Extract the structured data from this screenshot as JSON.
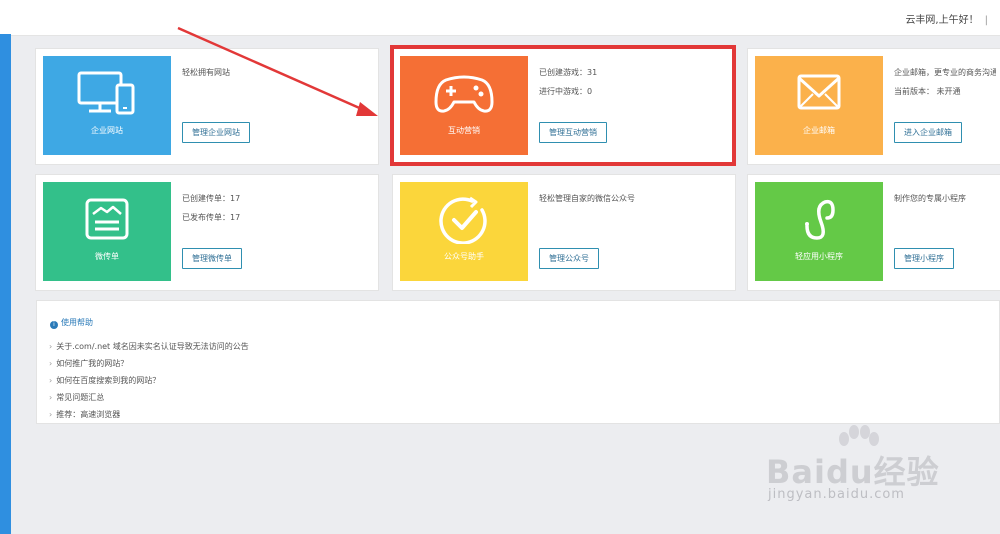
{
  "header": {
    "greeting": "云丰网,上午好！",
    "separator": "|"
  },
  "cards": [
    {
      "id": "website",
      "tile_label": "企业网站",
      "tile_color": "#3ea8e4",
      "icon": "monitor-phone-icon",
      "lines": [
        "轻松拥有网站"
      ],
      "button": "管理企业网站"
    },
    {
      "id": "marketing",
      "tile_label": "互动营销",
      "tile_color": "#f56f35",
      "icon": "gamepad-icon",
      "lines": [
        "已创建游戏：31",
        "进行中游戏：0"
      ],
      "button": "管理互动营销"
    },
    {
      "id": "mail",
      "tile_label": "企业邮箱",
      "tile_color": "#fbb14b",
      "icon": "envelope-icon",
      "lines": [
        "企业邮箱，更专业的商务沟通",
        "当前版本： 未开通"
      ],
      "button": "进入企业邮箱"
    },
    {
      "id": "flyer",
      "tile_label": "微传单",
      "tile_color": "#33c08a",
      "icon": "flyer-icon",
      "lines": [
        "已创建传单：17",
        "已发布传单：17"
      ],
      "button": "管理微传单"
    },
    {
      "id": "wechat",
      "tile_label": "公众号助手",
      "tile_color": "#fbd63b",
      "icon": "check-circle-icon",
      "lines": [
        "轻松管理自家的微信公众号"
      ],
      "button": "管理公众号"
    },
    {
      "id": "miniapp",
      "tile_label": "轻应用小程序",
      "tile_color": "#64c947",
      "icon": "miniprogram-icon",
      "lines": [
        "制作您的专属小程序"
      ],
      "button": "管理小程序"
    }
  ],
  "help": {
    "title": "使用帮助",
    "items": [
      "关于.com/.net 域名因未实名认证导致无法访问的公告",
      "如何推广我的网站？",
      "如何在百度搜索到我的网站？",
      "常见问题汇总",
      "推荐：高速浏览器"
    ]
  },
  "watermark": {
    "brand": "Baidu经验",
    "url": "jingyan.baidu.com"
  },
  "annotation_color": "#e23838"
}
